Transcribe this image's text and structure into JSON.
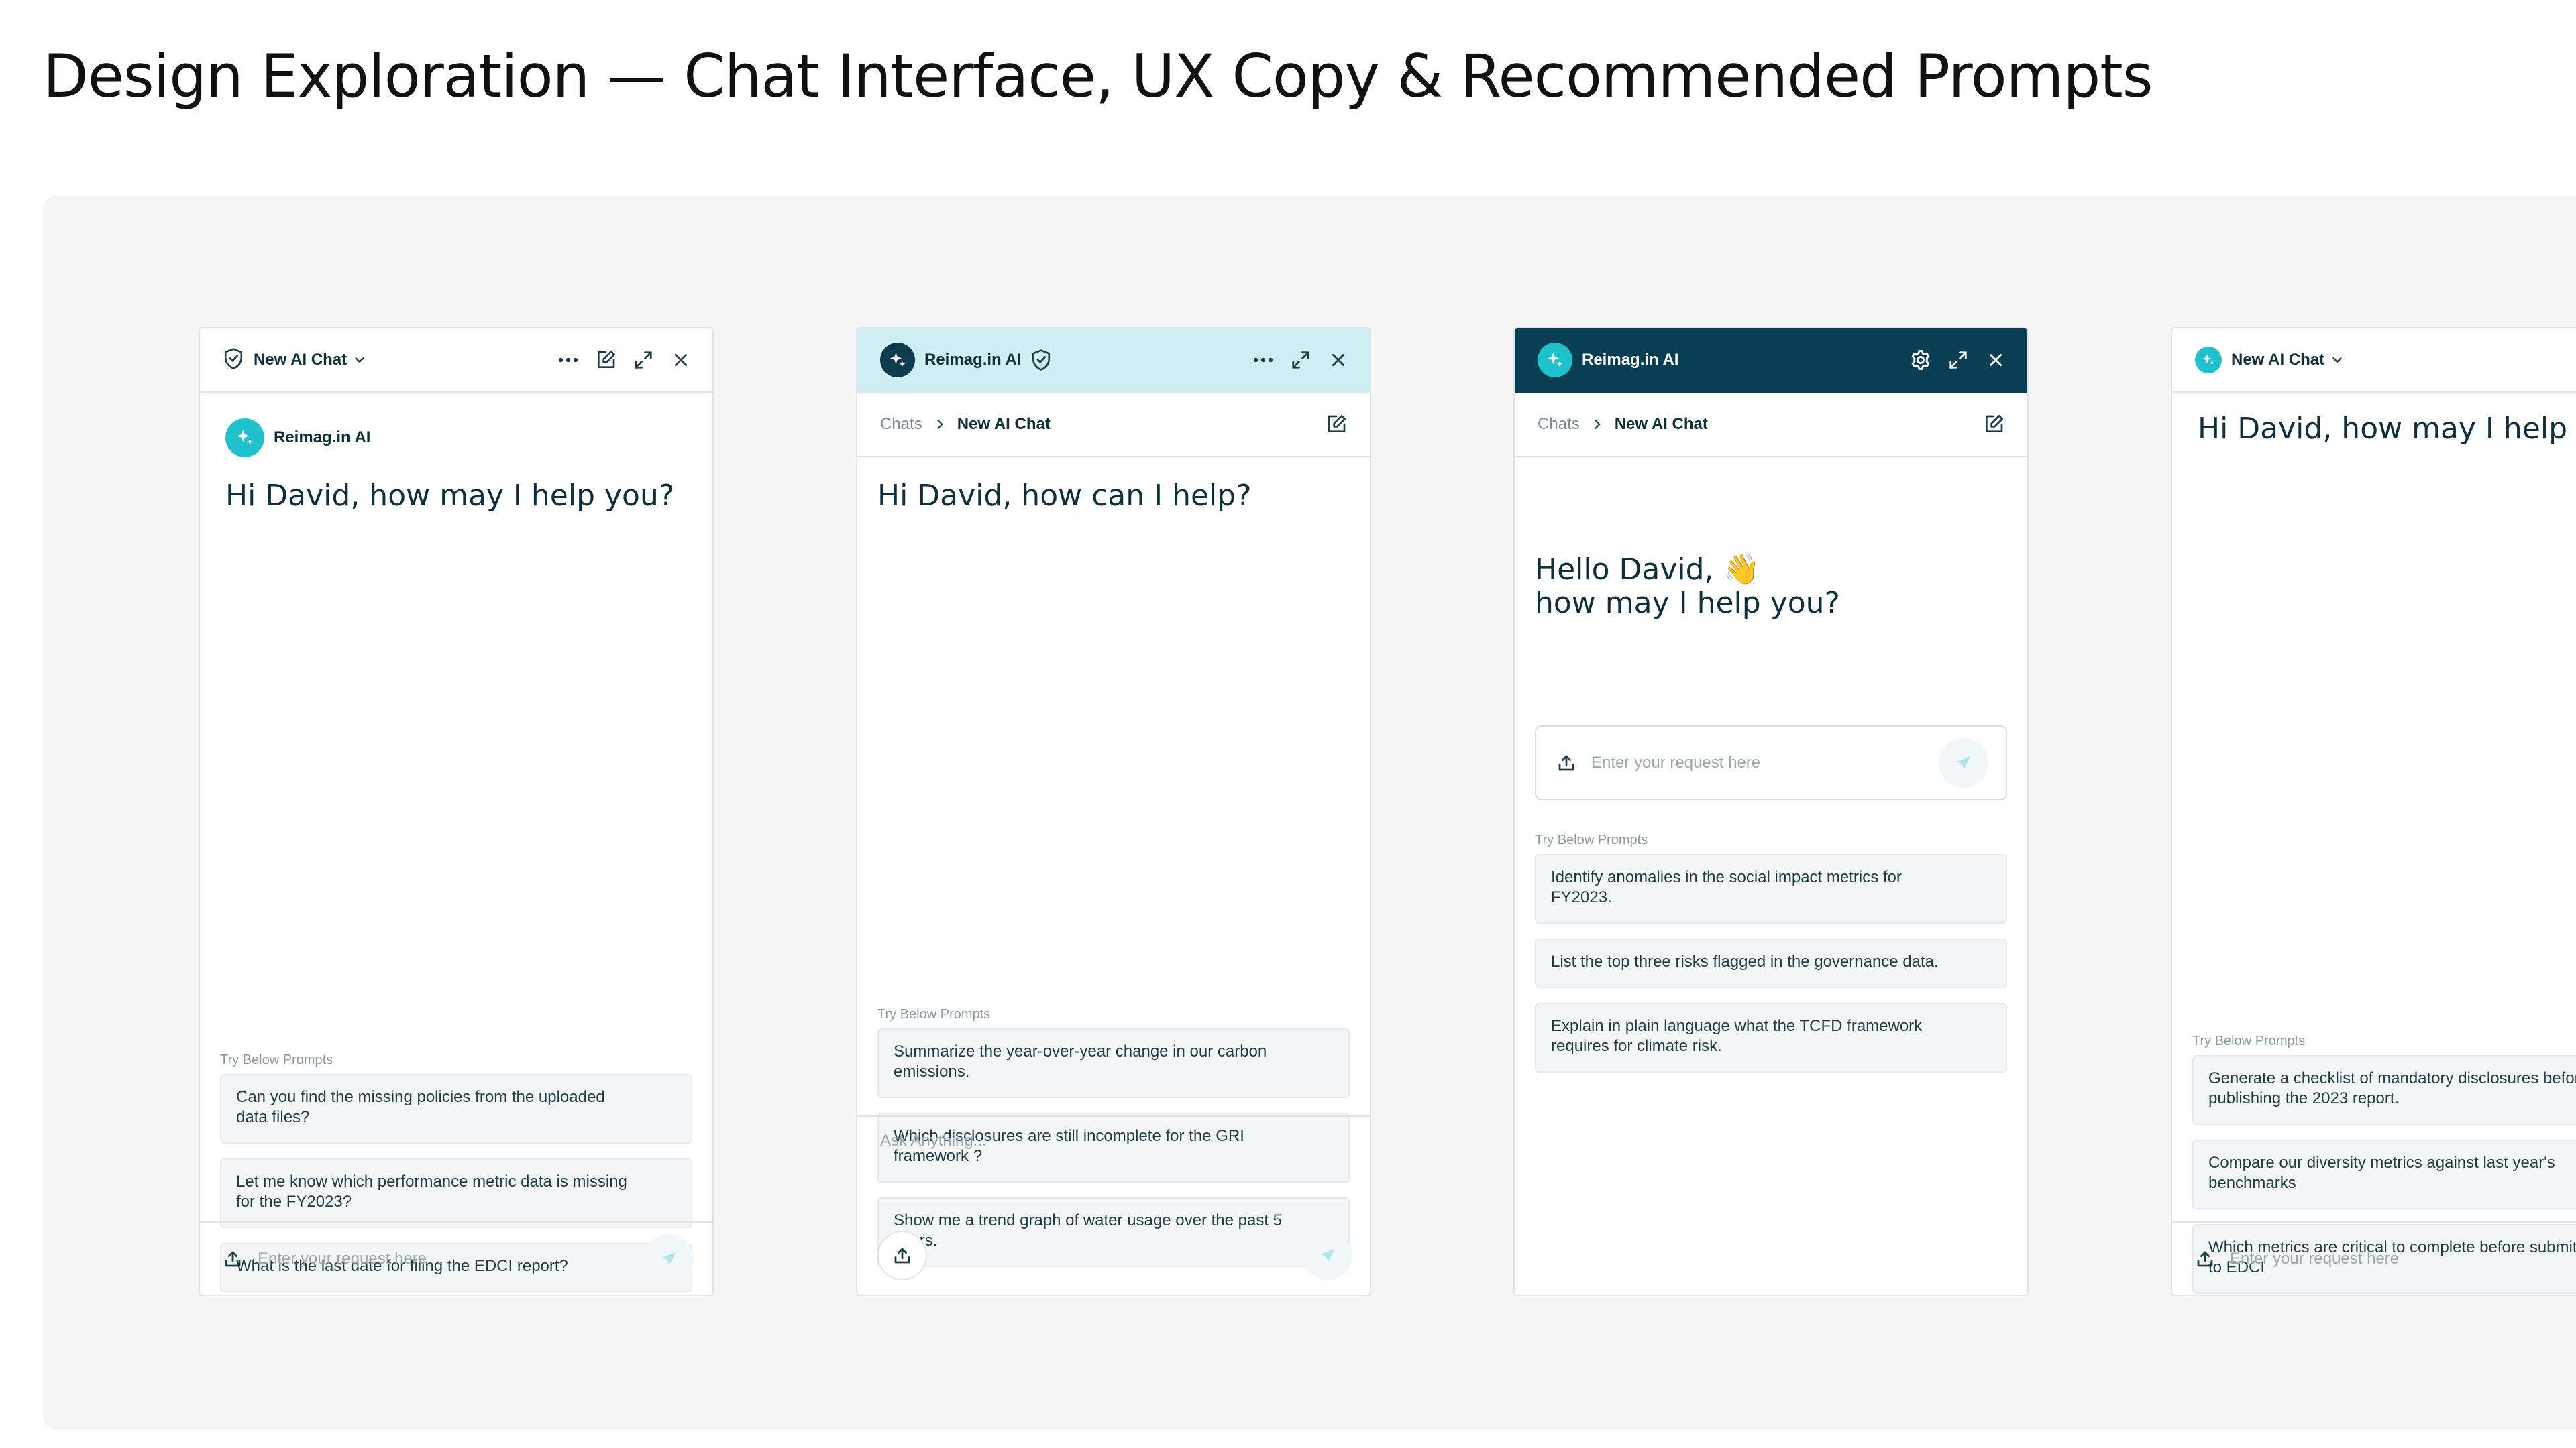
{
  "page": {
    "title": "Design Exploration — Chat Interface, UX Copy & Recommended Prompts"
  },
  "colors": {
    "accent_teal": "#1fc2cc",
    "header_cyan": "#cdeff4",
    "header_dark": "#0a3e52",
    "text_dark": "#0e2f3b",
    "canvas_bg": "#f5f5f5"
  },
  "panel1": {
    "header_title": "New AI Chat",
    "brand_name": "Reimag.in AI",
    "greeting": "Hi David, how may I help you?",
    "try_label": "Try Below Prompts",
    "prompts": [
      {
        "line1": "Can you find the missing policies from the uploaded",
        "line2": "data files?"
      },
      {
        "line1": "Let me know which performance metric data is missing",
        "line2": "for the FY2023?"
      },
      {
        "line1": "What is the last date for filing the EDCI report?",
        "line2": ""
      }
    ],
    "input_placeholder": "Enter your request here",
    "icons": [
      "shield-check-icon",
      "chevron-down-icon",
      "more-icon",
      "edit-icon",
      "expand-icon",
      "close-icon",
      "sparkle-icon",
      "upload-icon",
      "send-icon"
    ]
  },
  "panel2": {
    "header_title": "Reimag.in AI",
    "breadcrumb_root": "Chats",
    "breadcrumb_current": "New AI Chat",
    "greeting": "Hi David, how can I help?",
    "try_label": "Try Below Prompts",
    "prompts": [
      {
        "line1": "Summarize the year-over-year change in our carbon",
        "line2": "emissions."
      },
      {
        "line1": "Which disclosures are still incomplete for the GRI",
        "line2": "framework ?"
      },
      {
        "line1": "Show me a trend graph of water usage over the past 5",
        "line2": "years."
      }
    ],
    "input_placeholder": "Ask Anything..."
  },
  "panel3": {
    "header_title": "Reimag.in AI",
    "breadcrumb_root": "Chats",
    "breadcrumb_current": "New AI Chat",
    "greeting_line1": "Hello David, 👋",
    "greeting_line2": "how may I help you?",
    "input_placeholder": "Enter your request here",
    "try_label": "Try Below Prompts",
    "prompts": [
      {
        "line1": "Identify anomalies in the social impact metrics for",
        "line2": "FY2023."
      },
      {
        "line1": "List the top three risks flagged in the governance data.",
        "line2": ""
      },
      {
        "line1": "Explain in plain language what the TCFD framework",
        "line2": "requires for climate risk."
      }
    ]
  },
  "panel4": {
    "header_title": "New AI Chat",
    "greeting": "Hi David, how may I help you?",
    "try_label": "Try Below Prompts",
    "prompts": [
      {
        "line1": "Generate a checklist of mandatory disclosures before",
        "line2": "publishing the 2023 report."
      },
      {
        "line1": "Compare our diversity metrics against last year's",
        "line2": "benchmarks"
      },
      {
        "line1": "Which metrics are critical to complete before submitting",
        "line2": "to EDCI"
      }
    ],
    "input_placeholder": "Enter your request here"
  }
}
